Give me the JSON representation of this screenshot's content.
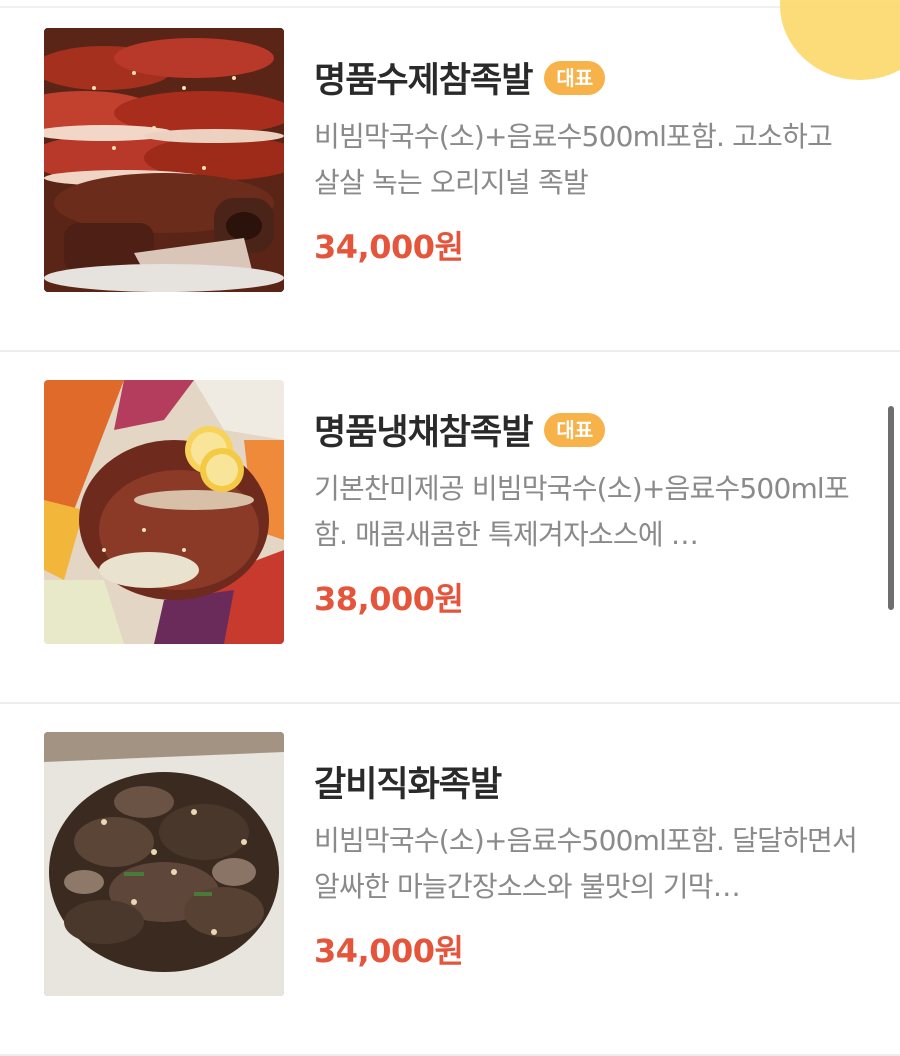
{
  "menu": {
    "items": [
      {
        "title": "명품수제참족발",
        "badge": "대표",
        "description": "비빔막국수(소)+음료수500ml포함. 고소하고 살살 녹는 오리지널 족발",
        "price": "34,000원",
        "image_icon": "pork-hock-sliced-photo"
      },
      {
        "title": "명품냉채참족발",
        "badge": "대표",
        "description": "기본찬미제공 비빔막국수(소)+음료수500ml포함. 매콤새콤한 특제겨자소스에 …",
        "price": "38,000원",
        "image_icon": "cold-pork-hock-salad-photo"
      },
      {
        "title": "갈비직화족발",
        "badge": "",
        "description": "비빔막국수(소)+음료수500ml포함. 달달하면서 알싸한 마늘간장소스와 불맛의 기막…",
        "price": "34,000원",
        "image_icon": "grilled-pork-hock-photo"
      }
    ]
  },
  "colors": {
    "price": "#e5553b",
    "badge": "#f7b24a",
    "title": "#2a2a2a",
    "description": "#8a8a8a"
  }
}
